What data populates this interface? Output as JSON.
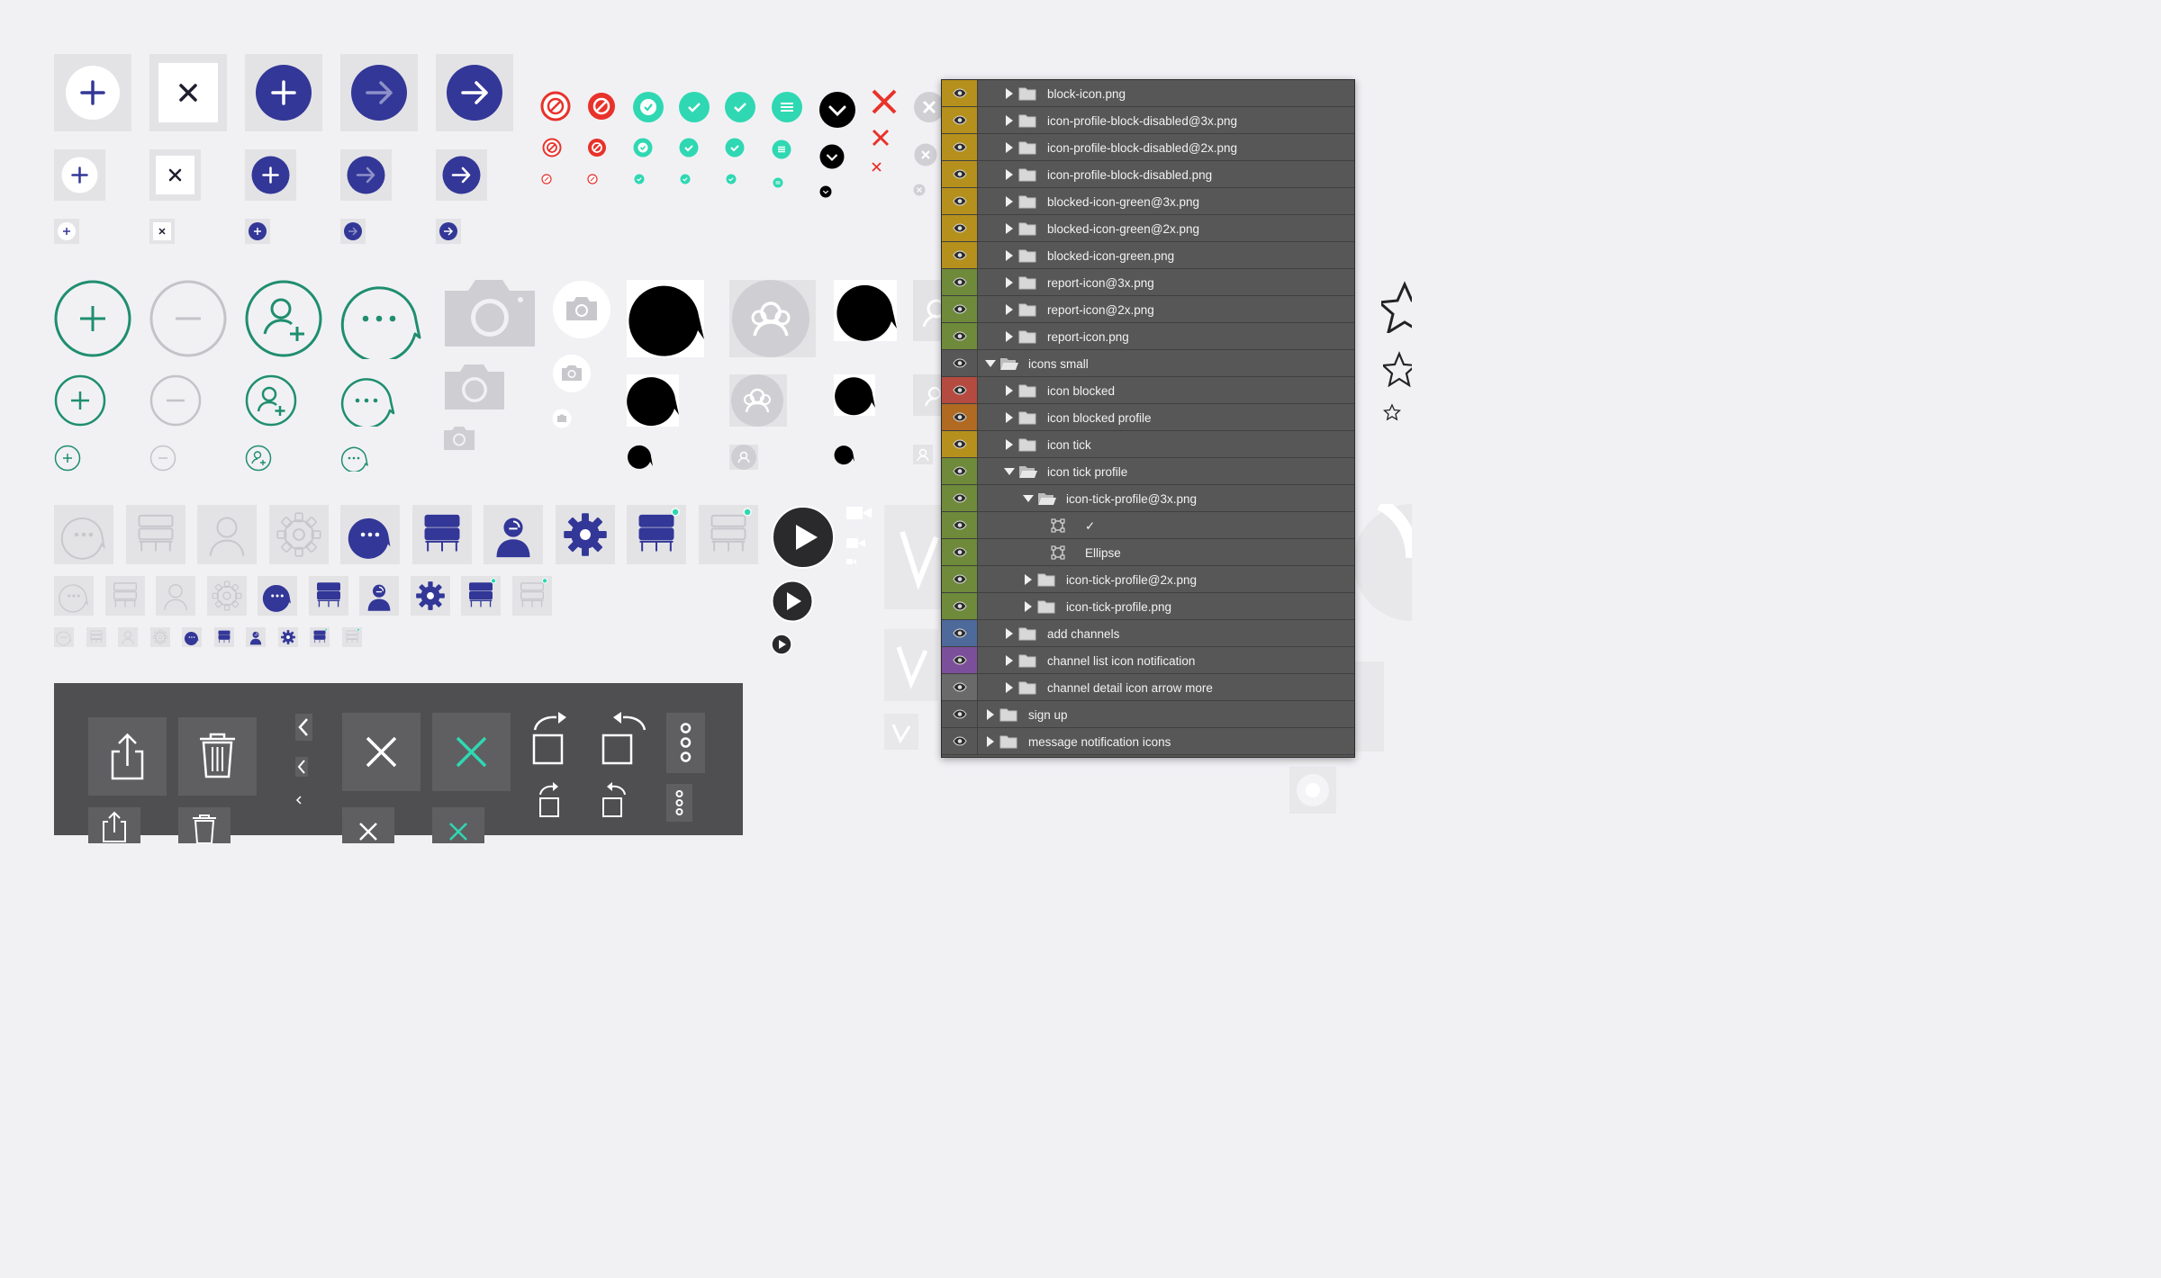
{
  "colors": {
    "page_bg": "#f1f1f4",
    "tile_bg": "#e3e3e6",
    "navy": "#333797",
    "green": "#1f8e6f",
    "teal": "#2fd8b2",
    "red": "#e8322a",
    "gray": "#c8c8cc",
    "dark_sheet": "#4f4f51",
    "panel_bg": "#575757"
  },
  "icon_sheet": {
    "row1": [
      "add-circle-icon",
      "close-icon",
      "add-filled-icon",
      "arrow-right-faded-icon",
      "arrow-right-filled-icon"
    ],
    "status": [
      "block-icon",
      "block-icon",
      "tick-icon",
      "tick-icon",
      "tick-icon",
      "menu-lines-icon",
      "chevron-down-icon",
      "close-red-icon",
      "close-gray-icon"
    ],
    "row2": [
      "add-outline-icon",
      "remove-outline-icon",
      "add-user-icon",
      "chat-bubble-icon",
      "camera-icon",
      "camera-circle-icon",
      "speech-bubble-icon",
      "group-icon"
    ],
    "row3": [
      "chat-icon",
      "channels-icon",
      "user-icon",
      "settings-icon",
      "notification-icon",
      "play-icon"
    ],
    "dark": [
      "share-icon",
      "trash-icon",
      "chevron-left-icon",
      "close-icon",
      "rotate-right-icon",
      "rotate-left-icon",
      "more-vertical-icon"
    ]
  },
  "layers_panel": {
    "rows": [
      {
        "label": "block-icon.png",
        "color": "#b5901c",
        "type": "folder",
        "state": "closed",
        "indent": 1
      },
      {
        "label": "icon-profile-block-disabled@3x.png",
        "color": "#b5901c",
        "type": "folder",
        "state": "closed",
        "indent": 1
      },
      {
        "label": "icon-profile-block-disabled@2x.png",
        "color": "#b5901c",
        "type": "folder",
        "state": "closed",
        "indent": 1
      },
      {
        "label": "icon-profile-block-disabled.png",
        "color": "#b5901c",
        "type": "folder",
        "state": "closed",
        "indent": 1
      },
      {
        "label": "blocked-icon-green@3x.png",
        "color": "#b5901c",
        "type": "folder",
        "state": "closed",
        "indent": 1
      },
      {
        "label": "blocked-icon-green@2x.png",
        "color": "#b5901c",
        "type": "folder",
        "state": "closed",
        "indent": 1
      },
      {
        "label": "blocked-icon-green.png",
        "color": "#b5901c",
        "type": "folder",
        "state": "closed",
        "indent": 1
      },
      {
        "label": "report-icon@3x.png",
        "color": "#6e8a3a",
        "type": "folder",
        "state": "closed",
        "indent": 1
      },
      {
        "label": "report-icon@2x.png",
        "color": "#6e8a3a",
        "type": "folder",
        "state": "closed",
        "indent": 1
      },
      {
        "label": "report-icon.png",
        "color": "#6e8a3a",
        "type": "folder",
        "state": "closed",
        "indent": 1
      },
      {
        "label": "icons small",
        "color": "#575757",
        "type": "folder",
        "state": "open",
        "indent": 0
      },
      {
        "label": "icon blocked",
        "color": "#b54a40",
        "type": "folder",
        "state": "closed",
        "indent": 1
      },
      {
        "label": "icon blocked profile",
        "color": "#b06a22",
        "type": "folder",
        "state": "closed",
        "indent": 1
      },
      {
        "label": "icon tick",
        "color": "#b5901c",
        "type": "folder",
        "state": "closed",
        "indent": 1
      },
      {
        "label": "icon tick profile",
        "color": "#6e8a3a",
        "type": "folder",
        "state": "open",
        "indent": 1
      },
      {
        "label": "icon-tick-profile@3x.png",
        "color": "#6e8a3a",
        "type": "folder",
        "state": "open",
        "indent": 2
      },
      {
        "label": "✓",
        "color": "#6e8a3a",
        "type": "shape",
        "state": "none",
        "indent": 3
      },
      {
        "label": "Ellipse",
        "color": "#6e8a3a",
        "type": "shape",
        "state": "none",
        "indent": 3
      },
      {
        "label": "icon-tick-profile@2x.png",
        "color": "#6e8a3a",
        "type": "folder",
        "state": "closed",
        "indent": 2
      },
      {
        "label": "icon-tick-profile.png",
        "color": "#6e8a3a",
        "type": "folder",
        "state": "closed",
        "indent": 2
      },
      {
        "label": "add channels",
        "color": "#4d6a9a",
        "type": "folder",
        "state": "closed",
        "indent": 1
      },
      {
        "label": "channel list icon notification",
        "color": "#7c4f9a",
        "type": "folder",
        "state": "closed",
        "indent": 1
      },
      {
        "label": "channel detail icon arrow more",
        "color": "#6a6a6a",
        "type": "folder",
        "state": "closed",
        "indent": 1
      },
      {
        "label": "sign up",
        "color": "#575757",
        "type": "folder",
        "state": "closed",
        "indent": 0
      },
      {
        "label": "message notification icons",
        "color": "#575757",
        "type": "folder",
        "state": "closed",
        "indent": 0
      }
    ]
  }
}
